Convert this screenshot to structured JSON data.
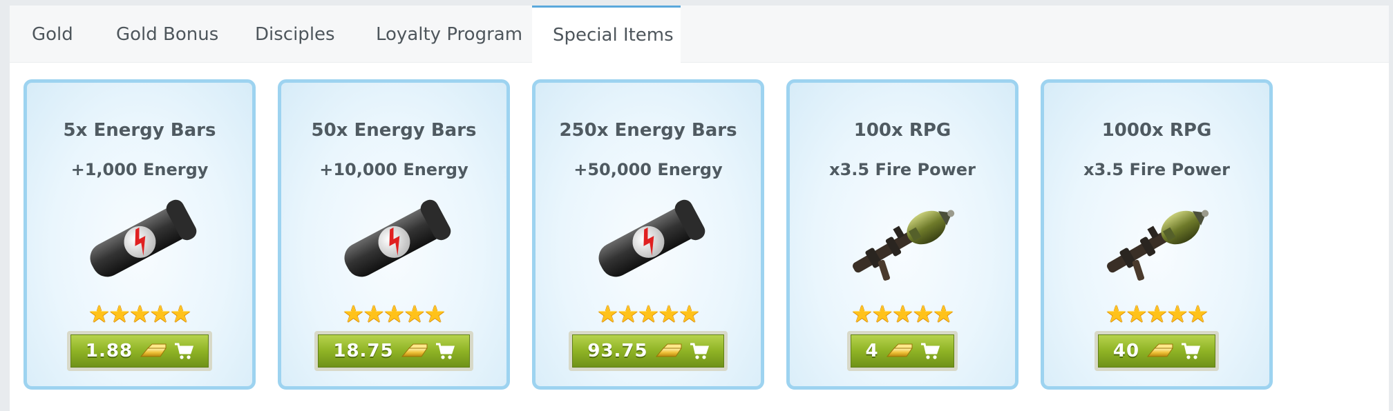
{
  "tabs": [
    {
      "label": "Gold"
    },
    {
      "label": "Gold Bonus"
    },
    {
      "label": "Disciples"
    },
    {
      "label": "Loyalty Program"
    },
    {
      "label": "Special Items",
      "active": true
    }
  ],
  "items": [
    {
      "title": "5x Energy Bars",
      "subtitle": "+1,000 Energy",
      "icon": "energy-bar-icon",
      "rating": 5,
      "stars": "★★★★★",
      "price": "1.88"
    },
    {
      "title": "50x Energy Bars",
      "subtitle": "+10,000 Energy",
      "icon": "energy-bar-icon",
      "rating": 5,
      "stars": "★★★★★",
      "price": "18.75"
    },
    {
      "title": "250x Energy Bars",
      "subtitle": "+50,000 Energy",
      "icon": "energy-bar-icon",
      "rating": 5,
      "stars": "★★★★★",
      "price": "93.75"
    },
    {
      "title": "100x RPG",
      "subtitle": "x3.5 Fire Power",
      "icon": "rpg-launcher-icon",
      "rating": 5,
      "stars": "★★★★★",
      "price": "4"
    },
    {
      "title": "1000x RPG",
      "subtitle": "x3.5 Fire Power",
      "icon": "rpg-launcher-icon",
      "rating": 5,
      "stars": "★★★★★",
      "price": "40"
    }
  ],
  "colors": {
    "card_border": "#9dd3f0",
    "buy_button": "#8fb325",
    "star": "#ffc21a",
    "active_tab_accent": "#5aa8dc"
  }
}
